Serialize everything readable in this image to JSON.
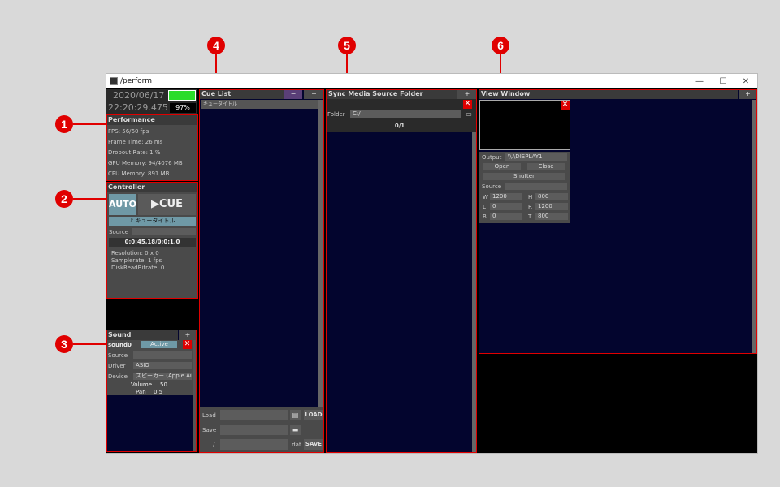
{
  "window": {
    "title": "/perform",
    "minimize": "—",
    "maximize": "☐",
    "close": "✕"
  },
  "status": {
    "date": "2020/06/17",
    "time": "22:20:29.475",
    "percent": "97%"
  },
  "performance": {
    "title": "Performance",
    "fps": "FPS: 56/60 fps",
    "frame_time": "Frame Time: 26 ms",
    "dropout": "Dropout Rate: 1 %",
    "gpu": "GPU Memory: 94/4076 MB",
    "cpu": "CPU Memory: 891 MB"
  },
  "controller": {
    "title": "Controller",
    "auto": "AUTO",
    "cue": "▶CUE",
    "cue_title": "♪ キュータイトル",
    "source_label": "Source",
    "timecode": "0:0:45.18/0:0:1.0",
    "resolution": "Resolution: 0 x 0",
    "samplerate": "Samplerate: 1 fps",
    "bitrate": "DiskReadBitrate: 0"
  },
  "sound": {
    "title": "Sound",
    "add": "+",
    "name": "sound0",
    "state": "Active",
    "source_label": "Source",
    "driver_label": "Driver",
    "driver": "ASIO",
    "device_label": "Device",
    "device": "スピーカー (Apple Audio",
    "volume_label": "Volume",
    "volume": "50",
    "pan_label": "Pan",
    "pan": "0.5"
  },
  "cue_list": {
    "title": "Cue List",
    "minus": "−",
    "plus": "+",
    "item0": "キュータイトル",
    "load_label": "Load",
    "save_label": "Save",
    "path_label": "/",
    "ext": ".dat",
    "load_btn": "LOAD",
    "save_btn": "SAVE"
  },
  "sync_folder": {
    "title": "Sync Media Source Folder",
    "plus": "+",
    "folder_label": "Folder",
    "folder": "C:/",
    "count": "0/1"
  },
  "view_window": {
    "title": "View Window",
    "plus": "+",
    "output_label": "Output",
    "output": "\\\\.\\DISPLAY1",
    "open": "Open",
    "close": "Close",
    "shutter": "Shutter",
    "source_label": "Source",
    "w_label": "W",
    "w": "1200",
    "h_label": "H",
    "h": "800",
    "l_label": "L",
    "l": "0",
    "r_label": "R",
    "r": "1200",
    "b_label": "B",
    "b": "0",
    "t_label": "T",
    "t": "800"
  },
  "callouts": [
    "1",
    "2",
    "3",
    "4",
    "5",
    "6"
  ]
}
